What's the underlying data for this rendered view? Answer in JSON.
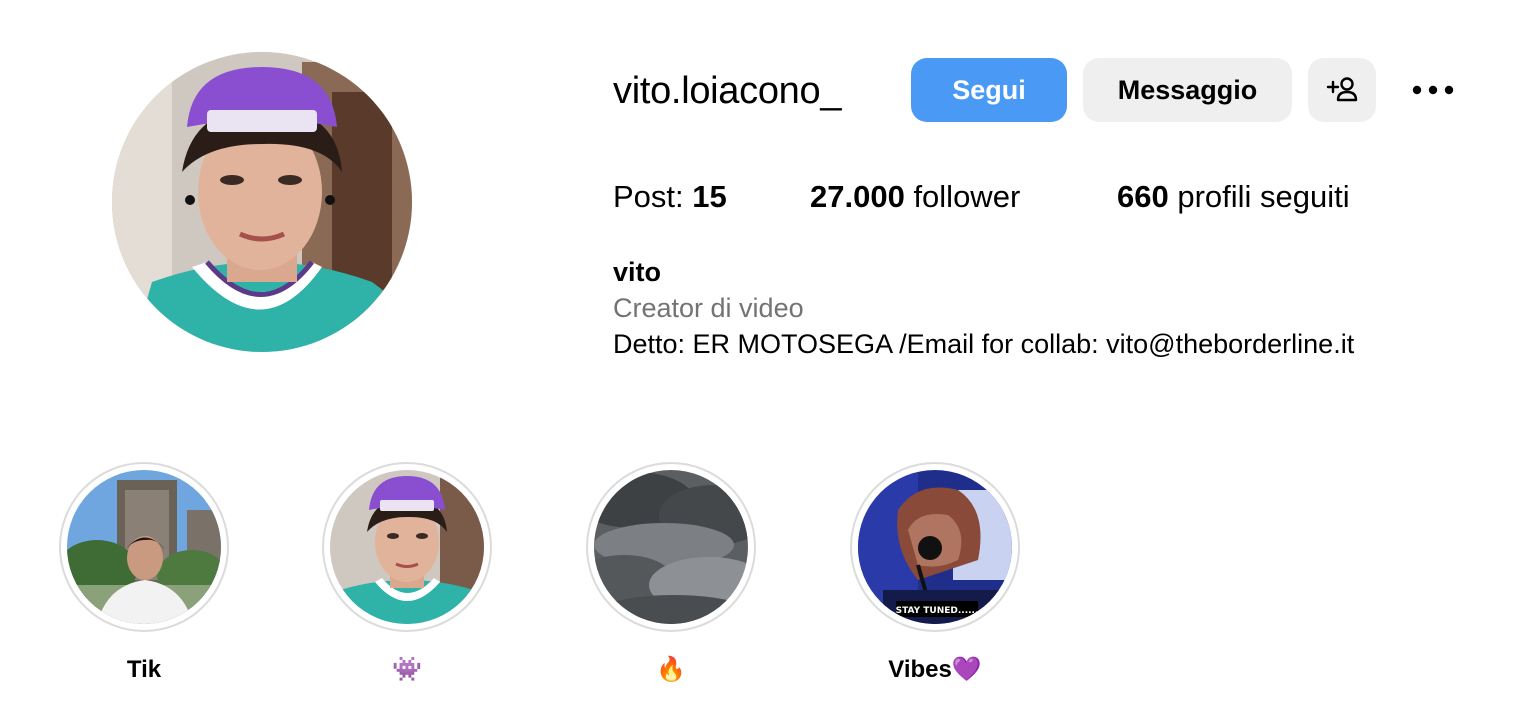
{
  "profile": {
    "username": "vito.loiacono_",
    "avatar_icon": "profile-photo"
  },
  "actions": {
    "follow_label": "Segui",
    "message_label": "Messaggio",
    "suggest_icon": "add-person-icon",
    "more_icon": "more-options-icon"
  },
  "stats": {
    "posts_label": "Post: ",
    "posts_value": "15",
    "followers_value": "27.000",
    "followers_label": " follower",
    "following_value": "660",
    "following_label": " profili seguiti"
  },
  "bio": {
    "name": "vito",
    "category": "Creator di video",
    "text": "Detto: ER MOTOSEGA /Email for collab: vito@theborderline.it"
  },
  "highlights": [
    {
      "label": "Tik"
    },
    {
      "label": "👾"
    },
    {
      "label": "🔥"
    },
    {
      "label": "Vibes💜"
    }
  ],
  "highlight_overlay_text": "STAY TUNED......",
  "colors": {
    "accent": "#4a9af5",
    "secondary_button": "#efefef",
    "muted_text": "#737373",
    "ring": "#dbdbdb"
  }
}
